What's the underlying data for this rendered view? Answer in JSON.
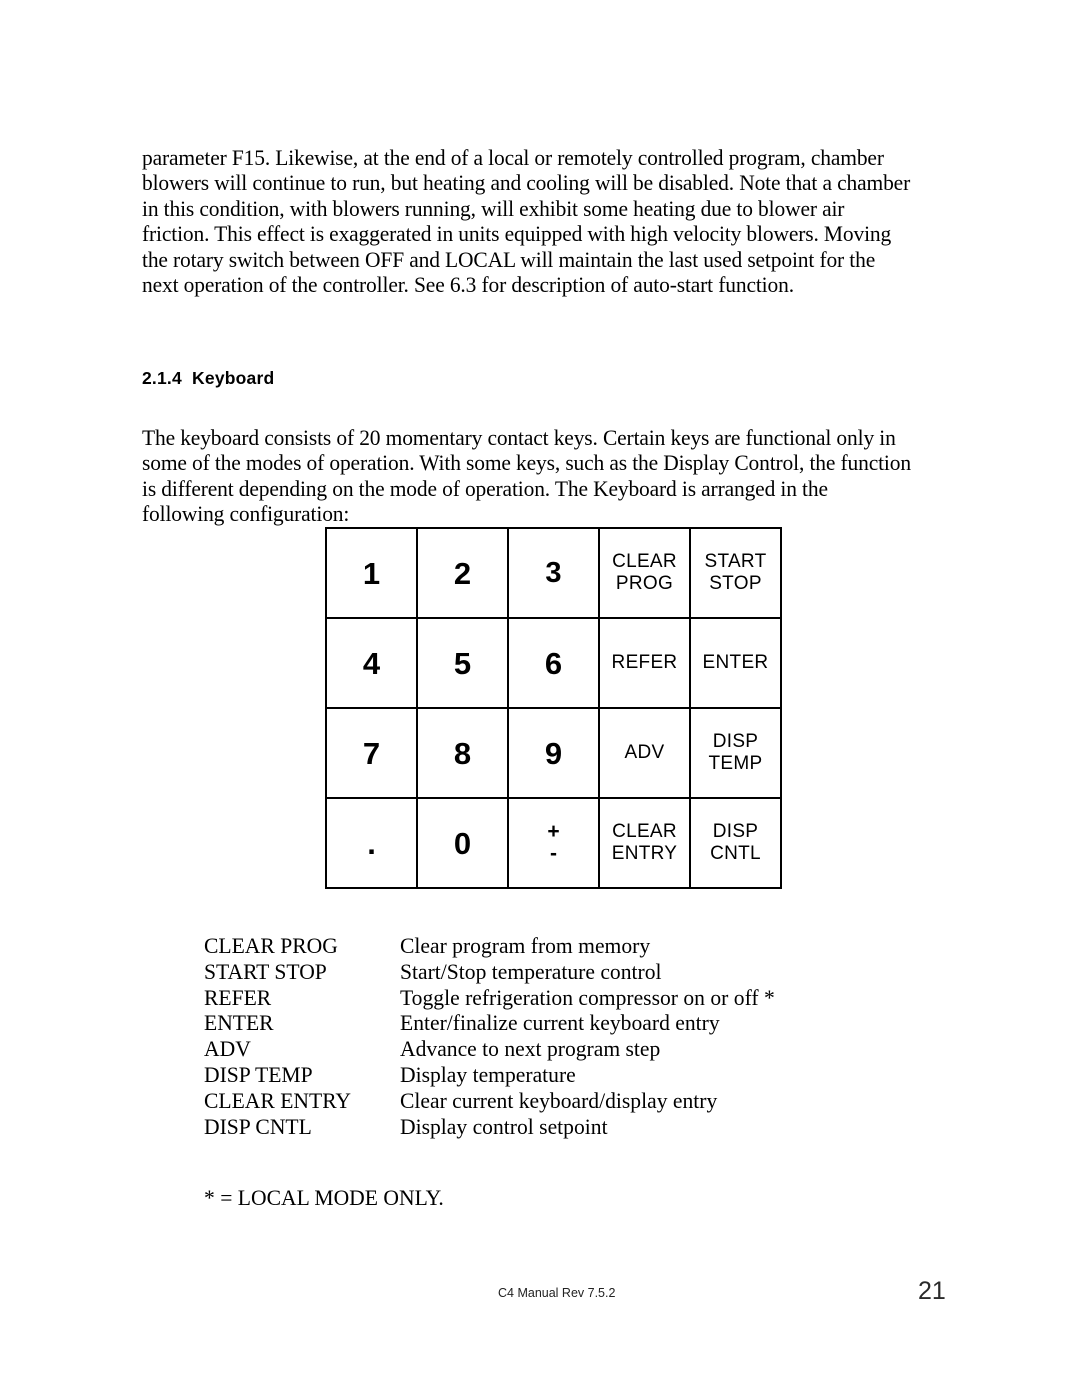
{
  "document": {
    "body_intro": "parameter F15.  Likewise, at the end of a local or remotely controlled program, chamber blowers will continue to run, but heating and cooling will be disabled.  Note that a chamber in this condition, with blowers running, will exhibit some heating due to blower air friction.  This effect is exaggerated in units equipped with high velocity blowers.  Moving the rotary switch between OFF and LOCAL will maintain the last used setpoint for the next operation of the controller.  See 6.3 for description of auto-start function.",
    "section_heading": "2.1.4  Keyboard",
    "body_keyboard": "The keyboard consists of 20 momentary contact keys. Certain keys are functional only in some of the modes of operation.  With some keys, such as the Display Control, the function is different depending on the mode of operation.  The Keyboard is arranged in the following configuration:",
    "footnote": "* = LOCAL MODE ONLY."
  },
  "keypad": {
    "rows": [
      [
        {
          "line1": "1",
          "line2": "",
          "kind": "digit"
        },
        {
          "line1": "2",
          "line2": "",
          "kind": "digit"
        },
        {
          "line1": "3",
          "line2": "",
          "kind": "digit-sm"
        },
        {
          "line1": "CLEAR",
          "line2": "PROG",
          "kind": "label"
        },
        {
          "line1": "START",
          "line2": "STOP",
          "kind": "label"
        }
      ],
      [
        {
          "line1": "4",
          "line2": "",
          "kind": "digit"
        },
        {
          "line1": "5",
          "line2": "",
          "kind": "digit"
        },
        {
          "line1": "6",
          "line2": "",
          "kind": "digit"
        },
        {
          "line1": "REFER",
          "line2": "",
          "kind": "label"
        },
        {
          "line1": "ENTER",
          "line2": "",
          "kind": "label"
        }
      ],
      [
        {
          "line1": "7",
          "line2": "",
          "kind": "digit"
        },
        {
          "line1": "8",
          "line2": "",
          "kind": "digit"
        },
        {
          "line1": "9",
          "line2": "",
          "kind": "digit"
        },
        {
          "line1": "ADV",
          "line2": "",
          "kind": "label"
        },
        {
          "line1": "DISP",
          "line2": "TEMP",
          "kind": "label"
        }
      ],
      [
        {
          "line1": ".",
          "line2": "",
          "kind": "dot"
        },
        {
          "line1": "0",
          "line2": "",
          "kind": "digit"
        },
        {
          "line1": "+",
          "line2": "-",
          "kind": "plusminus"
        },
        {
          "line1": "CLEAR",
          "line2": "ENTRY",
          "kind": "label"
        },
        {
          "line1": "DISP",
          "line2": "CNTL",
          "kind": "label"
        }
      ]
    ]
  },
  "legend": {
    "entries": [
      {
        "term": "CLEAR PROG",
        "desc": "Clear program from memory"
      },
      {
        "term": "START STOP",
        "desc": "Start/Stop temperature control"
      },
      {
        "term": "REFER",
        "desc": "Toggle refrigeration compressor on or off *"
      },
      {
        "term": "ENTER",
        "desc": "Enter/finalize current keyboard entry"
      },
      {
        "term": "ADV",
        "desc": "Advance to next program step"
      },
      {
        "term": "DISP TEMP",
        "desc": "Display temperature"
      },
      {
        "term": "CLEAR ENTRY",
        "desc": "Clear current keyboard/display entry"
      },
      {
        "term": "DISP CNTL",
        "desc": "Display control setpoint"
      }
    ]
  },
  "footer": {
    "manual_label": "C4 Manual Rev 7.5.2",
    "page_number": "21"
  }
}
